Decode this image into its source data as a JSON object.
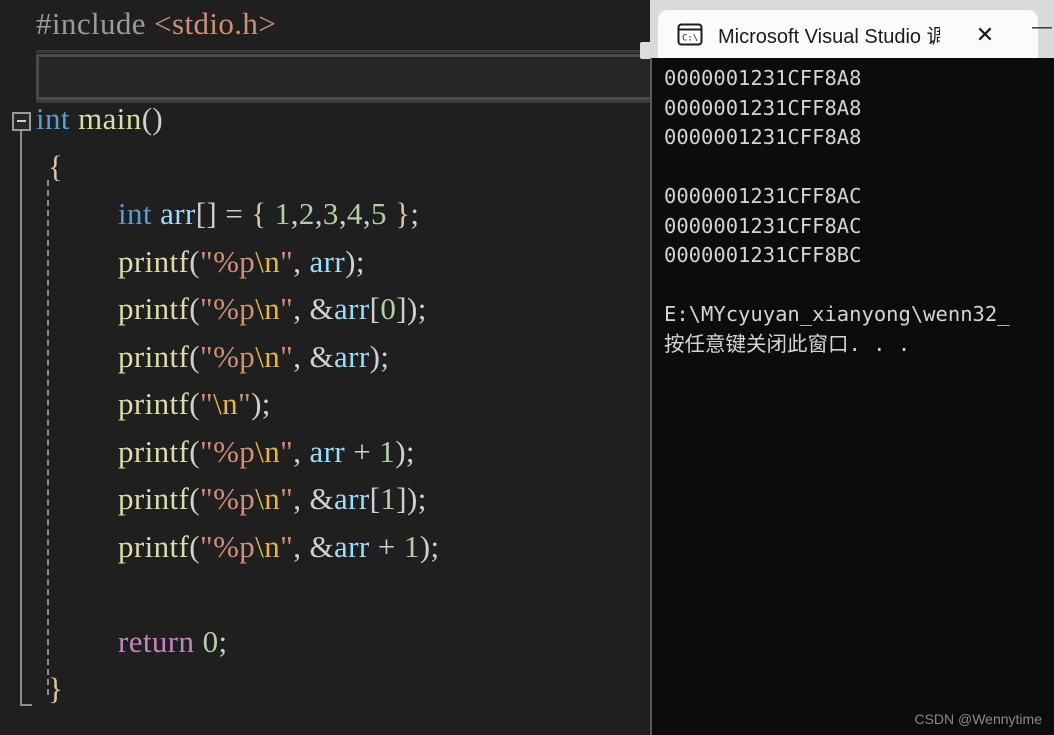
{
  "editor": {
    "name": "visual-studio-code-editor",
    "background": "#1f1f1f",
    "fold_marker": "minus",
    "scrollbar_visible": true,
    "code_lines": [
      {
        "indent": 0,
        "tokens": [
          {
            "text": "#include",
            "cls": "t-pre"
          },
          {
            "text": " ",
            "cls": "t-punc"
          },
          {
            "text": "<stdio.h>",
            "cls": "t-inc"
          }
        ]
      },
      {
        "indent": 0,
        "tokens": []
      },
      {
        "indent": 0,
        "tokens": [
          {
            "text": "int",
            "cls": "t-kw"
          },
          {
            "text": " ",
            "cls": "t-punc"
          },
          {
            "text": "main",
            "cls": "t-fn"
          },
          {
            "text": "()",
            "cls": "t-punc"
          }
        ]
      },
      {
        "indent": 1,
        "tokens": [
          {
            "text": "{",
            "cls": "t-brace"
          }
        ]
      },
      {
        "indent": 2,
        "tokens": [
          {
            "text": "int",
            "cls": "t-kw"
          },
          {
            "text": " ",
            "cls": "t-punc"
          },
          {
            "text": "arr",
            "cls": "t-var"
          },
          {
            "text": "[] ",
            "cls": "t-punc"
          },
          {
            "text": "= ",
            "cls": "t-op"
          },
          {
            "text": "{ ",
            "cls": "t-brace"
          },
          {
            "text": "1",
            "cls": "t-num"
          },
          {
            "text": ",",
            "cls": "t-punc"
          },
          {
            "text": "2",
            "cls": "t-num"
          },
          {
            "text": ",",
            "cls": "t-punc"
          },
          {
            "text": "3",
            "cls": "t-num"
          },
          {
            "text": ",",
            "cls": "t-punc"
          },
          {
            "text": "4",
            "cls": "t-num"
          },
          {
            "text": ",",
            "cls": "t-punc"
          },
          {
            "text": "5",
            "cls": "t-num"
          },
          {
            "text": " }",
            "cls": "t-brace"
          },
          {
            "text": ";",
            "cls": "t-punc"
          }
        ]
      },
      {
        "indent": 2,
        "tokens": [
          {
            "text": "printf",
            "cls": "t-fn"
          },
          {
            "text": "(",
            "cls": "t-punc"
          },
          {
            "text": "\"%p",
            "cls": "t-str"
          },
          {
            "text": "\\n",
            "cls": "t-esc"
          },
          {
            "text": "\"",
            "cls": "t-str"
          },
          {
            "text": ", ",
            "cls": "t-punc"
          },
          {
            "text": "arr",
            "cls": "t-var"
          },
          {
            "text": ");",
            "cls": "t-punc"
          }
        ]
      },
      {
        "indent": 2,
        "tokens": [
          {
            "text": "printf",
            "cls": "t-fn"
          },
          {
            "text": "(",
            "cls": "t-punc"
          },
          {
            "text": "\"%p",
            "cls": "t-str"
          },
          {
            "text": "\\n",
            "cls": "t-esc"
          },
          {
            "text": "\"",
            "cls": "t-str"
          },
          {
            "text": ", ",
            "cls": "t-punc"
          },
          {
            "text": "&",
            "cls": "t-op"
          },
          {
            "text": "arr",
            "cls": "t-var"
          },
          {
            "text": "[",
            "cls": "t-punc"
          },
          {
            "text": "0",
            "cls": "t-num"
          },
          {
            "text": "]);",
            "cls": "t-punc"
          }
        ]
      },
      {
        "indent": 2,
        "tokens": [
          {
            "text": "printf",
            "cls": "t-fn"
          },
          {
            "text": "(",
            "cls": "t-punc"
          },
          {
            "text": "\"%p",
            "cls": "t-str"
          },
          {
            "text": "\\n",
            "cls": "t-esc"
          },
          {
            "text": "\"",
            "cls": "t-str"
          },
          {
            "text": ", ",
            "cls": "t-punc"
          },
          {
            "text": "&",
            "cls": "t-op"
          },
          {
            "text": "arr",
            "cls": "t-var"
          },
          {
            "text": ");",
            "cls": "t-punc"
          }
        ]
      },
      {
        "indent": 2,
        "tokens": [
          {
            "text": "printf",
            "cls": "t-fn"
          },
          {
            "text": "(",
            "cls": "t-punc"
          },
          {
            "text": "\"",
            "cls": "t-str"
          },
          {
            "text": "\\n",
            "cls": "t-esc"
          },
          {
            "text": "\"",
            "cls": "t-str"
          },
          {
            "text": ");",
            "cls": "t-punc"
          }
        ]
      },
      {
        "indent": 2,
        "tokens": [
          {
            "text": "printf",
            "cls": "t-fn"
          },
          {
            "text": "(",
            "cls": "t-punc"
          },
          {
            "text": "\"%p",
            "cls": "t-str"
          },
          {
            "text": "\\n",
            "cls": "t-esc"
          },
          {
            "text": "\"",
            "cls": "t-str"
          },
          {
            "text": ", ",
            "cls": "t-punc"
          },
          {
            "text": "arr",
            "cls": "t-var"
          },
          {
            "text": " + ",
            "cls": "t-op"
          },
          {
            "text": "1",
            "cls": "t-num"
          },
          {
            "text": ");",
            "cls": "t-punc"
          }
        ]
      },
      {
        "indent": 2,
        "tokens": [
          {
            "text": "printf",
            "cls": "t-fn"
          },
          {
            "text": "(",
            "cls": "t-punc"
          },
          {
            "text": "\"%p",
            "cls": "t-str"
          },
          {
            "text": "\\n",
            "cls": "t-esc"
          },
          {
            "text": "\"",
            "cls": "t-str"
          },
          {
            "text": ", ",
            "cls": "t-punc"
          },
          {
            "text": "&",
            "cls": "t-op"
          },
          {
            "text": "arr",
            "cls": "t-var"
          },
          {
            "text": "[",
            "cls": "t-punc"
          },
          {
            "text": "1",
            "cls": "t-num"
          },
          {
            "text": "]);",
            "cls": "t-punc"
          }
        ]
      },
      {
        "indent": 2,
        "tokens": [
          {
            "text": "printf",
            "cls": "t-fn"
          },
          {
            "text": "(",
            "cls": "t-punc"
          },
          {
            "text": "\"%p",
            "cls": "t-str"
          },
          {
            "text": "\\n",
            "cls": "t-esc"
          },
          {
            "text": "\"",
            "cls": "t-str"
          },
          {
            "text": ", ",
            "cls": "t-punc"
          },
          {
            "text": "&",
            "cls": "t-op"
          },
          {
            "text": "arr",
            "cls": "t-var"
          },
          {
            "text": " + ",
            "cls": "t-op"
          },
          {
            "text": "1",
            "cls": "t-num"
          },
          {
            "text": ");",
            "cls": "t-punc"
          }
        ]
      },
      {
        "indent": 0,
        "tokens": []
      },
      {
        "indent": 2,
        "tokens": [
          {
            "text": "return",
            "cls": "t-ctl"
          },
          {
            "text": " ",
            "cls": "t-punc"
          },
          {
            "text": "0",
            "cls": "t-num"
          },
          {
            "text": ";",
            "cls": "t-punc"
          }
        ]
      },
      {
        "indent": 1,
        "tokens": [
          {
            "text": "}",
            "cls": "t-brace"
          }
        ]
      }
    ]
  },
  "console_window": {
    "icon": "console-cmd-icon",
    "icon_label": "C:\\",
    "title": "Microsoft Visual Studio 调试控",
    "close_label": "✕",
    "minimize_label": "—",
    "background": "#0c0c0c",
    "titlebar_background": "#dadada",
    "output_lines": [
      {
        "text": "0000001231CFF8A8",
        "blank": false
      },
      {
        "text": "0000001231CFF8A8",
        "blank": false
      },
      {
        "text": "0000001231CFF8A8",
        "blank": false
      },
      {
        "text": "",
        "blank": true
      },
      {
        "text": "0000001231CFF8AC",
        "blank": false
      },
      {
        "text": "0000001231CFF8AC",
        "blank": false
      },
      {
        "text": "0000001231CFF8BC",
        "blank": false
      },
      {
        "text": "",
        "blank": true
      },
      {
        "text": "E:\\MYcyuyan_xianyong\\wenn32_",
        "blank": false
      },
      {
        "text": "按任意键关闭此窗口. . .",
        "blank": false
      }
    ]
  },
  "watermark": "CSDN @Wennytime"
}
